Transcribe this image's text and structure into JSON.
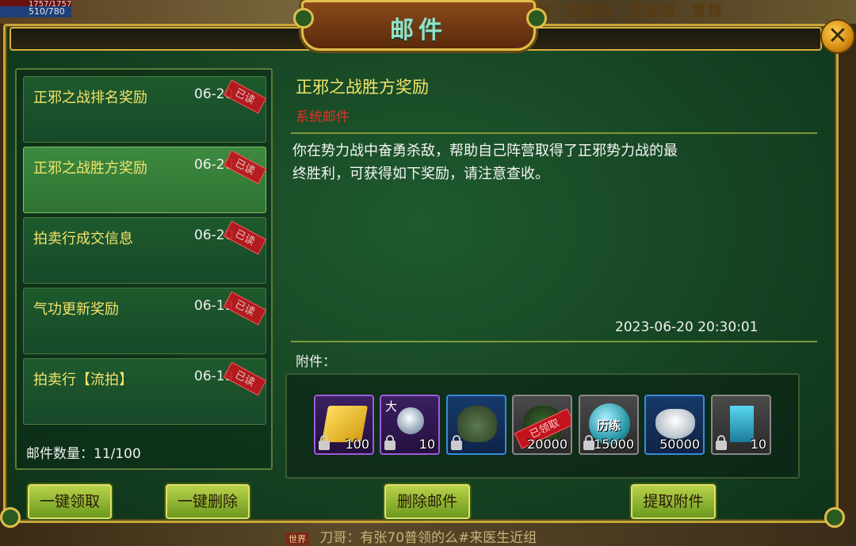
{
  "hud": {
    "hp_text": "1757/1757",
    "mp_text": "510/780",
    "top_menu": [
      "战",
      "拍卖行",
      "百宝阁",
      "首领"
    ]
  },
  "window": {
    "title": "邮件",
    "close_label": "✕"
  },
  "mail_list": {
    "items": [
      {
        "subject": "正邪之战排名奖励",
        "date": "06-20",
        "status": "已读"
      },
      {
        "subject": "正邪之战胜方奖励",
        "date": "06-20",
        "status": "已读",
        "selected": true
      },
      {
        "subject": "拍卖行成交信息",
        "date": "06-20",
        "status": "已读"
      },
      {
        "subject": "气功更新奖励",
        "date": "06-19",
        "status": "已读"
      },
      {
        "subject": "拍卖行【流拍】",
        "date": "06-19",
        "status": "已读"
      }
    ],
    "count_label": "邮件数量：11/100"
  },
  "detail": {
    "title": "正邪之战胜方奖励",
    "sender": "系统邮件",
    "body_line1": "你在势力战中奋勇杀敌，帮助自己阵营取得了正邪势力战的最",
    "body_line2": "终胜利，可获得如下奖励，请注意查收。",
    "time": "2023-06-20  20:30:01",
    "attach_label": "附件："
  },
  "attachments": [
    {
      "icon": "gold-bars-icon",
      "qty": "100",
      "rarity": "purple"
    },
    {
      "icon": "pearl-icon",
      "qty": "10",
      "rarity": "purple",
      "tag": "大"
    },
    {
      "icon": "jar-icon",
      "qty": "",
      "rarity": "blue"
    },
    {
      "icon": "claimed-item-icon",
      "qty": "20000",
      "rarity": "gray",
      "stamp": "已领取"
    },
    {
      "icon": "experience-orb-icon",
      "qty": "15000",
      "rarity": "gray",
      "label": "历练"
    },
    {
      "icon": "silver-ingot-icon",
      "qty": "50000",
      "rarity": "blue"
    },
    {
      "icon": "scroll-icon",
      "qty": "10",
      "rarity": "gray"
    }
  ],
  "buttons": {
    "claim_all": "一键领取",
    "delete_all": "一键删除",
    "delete_mail": "删除邮件",
    "extract_attach": "提取附件"
  },
  "chat": {
    "channel": "世界",
    "text": "刀哥：有张70普领的么#来医生近组"
  },
  "colors": {
    "panel_green": "#164423",
    "gold_border": "#c8a53a",
    "subject_yellow": "#f2e36a",
    "sender_red": "#e0322a",
    "button_green": "#8ab22e"
  }
}
